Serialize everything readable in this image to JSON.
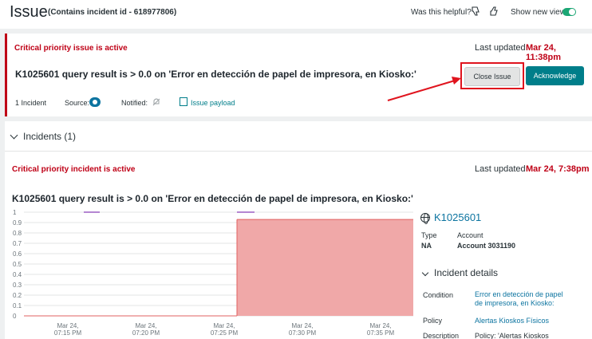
{
  "header": {
    "title": "Issue",
    "subtitle": "(Contains incident id - 618977806)",
    "helpful_label": "Was this helpful?",
    "new_view_label": "Show new view"
  },
  "issue": {
    "priority_text": "Critical priority issue is active",
    "last_updated_label": "Last updated",
    "last_updated_value": "Mar 24, 11:38pm",
    "title": "K1025601 query result is > 0.0 on 'Error en detección de papel de impresora, en Kiosko:'",
    "incident_count": "1 Incident",
    "source_label": "Source:",
    "notified_label": "Notified:",
    "payload_label": "Issue payload",
    "close_button": "Close Issue",
    "ack_button": "Acknowledge"
  },
  "incidents": {
    "section_title": "Incidents (1)",
    "priority_text": "Critical priority incident is active",
    "last_updated_label": "Last updated",
    "last_updated_value": "Mar 24, 7:38pm",
    "title": "K1025601 query result is > 0.0 on 'Error en detección de papel de impresora, en Kiosko:'"
  },
  "entity": {
    "name": "K1025601",
    "type_label": "Type",
    "type_value": "NA",
    "account_label": "Account",
    "account_value": "Account 3031190"
  },
  "incident_details": {
    "title": "Incident details",
    "condition_label": "Condition",
    "condition_value_line1": "Error en detección de papel",
    "condition_value_line2": "de impresora, en Kiosko:",
    "policy_label": "Policy",
    "policy_value": "Alertas Kioskos Físicos",
    "description_label": "Description",
    "description_value": "Policy: 'Alertas Kioskos"
  },
  "chart_data": {
    "type": "area",
    "y_ticks": [
      "1",
      "0.9",
      "0.8",
      "0.7",
      "0.6",
      "0.5",
      "0.4",
      "0.3",
      "0.2",
      "0.1",
      "0"
    ],
    "ylim": [
      0,
      1
    ],
    "x_ticks": [
      {
        "date": "Mar 24,",
        "time": "07:15 PM"
      },
      {
        "date": "Mar 24,",
        "time": "07:20 PM"
      },
      {
        "date": "Mar 24,",
        "time": "07:25 PM"
      },
      {
        "date": "Mar 24,",
        "time": "07:30 PM"
      },
      {
        "date": "Mar 24,",
        "time": "07:35 PM"
      }
    ],
    "series": [
      {
        "values": [
          0,
          0,
          0,
          1,
          1,
          1
        ]
      }
    ],
    "threshold_region": {
      "start": "07:26 PM",
      "end": "07:38 PM"
    },
    "colors": {
      "threshold": "#f0a8a8",
      "threshold_edge": "#e06060",
      "line": "#9c5fc4",
      "grid": "#e3e4e4"
    }
  },
  "colors": {
    "critical": "#bf0016",
    "teal": "#007e8a",
    "link": "#0c74a0",
    "annotation": "#e0141e"
  }
}
